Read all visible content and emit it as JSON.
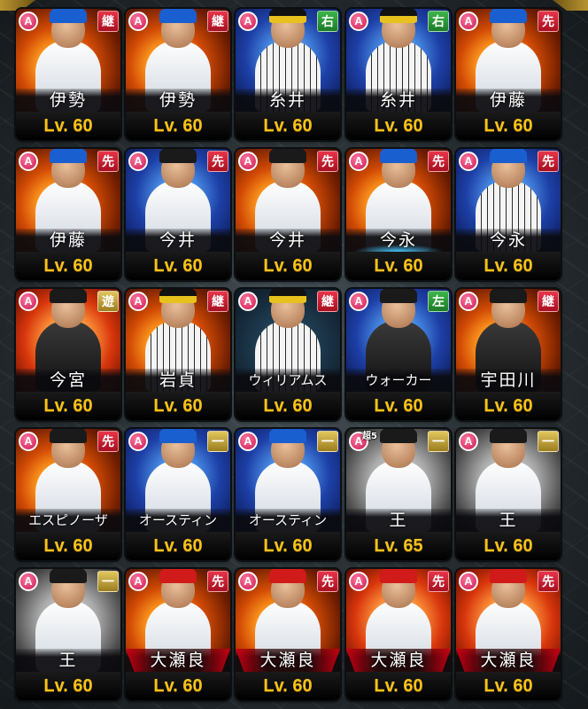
{
  "cards": [
    {
      "name": "伊勢",
      "level": "Lv. 60",
      "position": "継",
      "pos_color": "red",
      "art": "orange",
      "uniform": "white",
      "cap": "blue"
    },
    {
      "name": "伊勢",
      "level": "Lv. 60",
      "position": "継",
      "pos_color": "red",
      "art": "orange",
      "uniform": "white",
      "cap": "blue"
    },
    {
      "name": "糸井",
      "level": "Lv. 60",
      "position": "右",
      "pos_color": "green",
      "art": "blue",
      "uniform": "stripe",
      "cap": "yellow"
    },
    {
      "name": "糸井",
      "level": "Lv. 60",
      "position": "右",
      "pos_color": "green",
      "art": "blue",
      "uniform": "stripe",
      "cap": "yellow"
    },
    {
      "name": "伊藤",
      "level": "Lv. 60",
      "position": "先",
      "pos_color": "red",
      "art": "orange",
      "uniform": "white",
      "cap": "blue"
    },
    {
      "name": "伊藤",
      "level": "Lv. 60",
      "position": "先",
      "pos_color": "red",
      "art": "orange",
      "uniform": "white",
      "cap": "blue"
    },
    {
      "name": "今井",
      "level": "Lv. 60",
      "position": "先",
      "pos_color": "red",
      "art": "blue",
      "uniform": "white",
      "cap": "black"
    },
    {
      "name": "今井",
      "level": "Lv. 60",
      "position": "先",
      "pos_color": "red",
      "art": "orange",
      "uniform": "white",
      "cap": "black"
    },
    {
      "name": "今永",
      "level": "Lv. 60",
      "position": "先",
      "pos_color": "red",
      "art": "orange",
      "uniform": "white",
      "cap": "blue",
      "glow": true
    },
    {
      "name": "今永",
      "level": "Lv. 60",
      "position": "先",
      "pos_color": "red",
      "art": "blue",
      "uniform": "stripe",
      "cap": "blue"
    },
    {
      "name": "今宮",
      "level": "Lv. 60",
      "position": "遊",
      "pos_color": "gold",
      "art": "red",
      "uniform": "black",
      "cap": "black"
    },
    {
      "name": "岩貞",
      "level": "Lv. 60",
      "position": "継",
      "pos_color": "red",
      "art": "orange",
      "uniform": "stripe",
      "cap": "yellow"
    },
    {
      "name": "ウィリアムス",
      "level": "Lv. 60",
      "position": "継",
      "pos_color": "red",
      "art": "dark",
      "uniform": "stripe",
      "cap": "yellow",
      "small": true
    },
    {
      "name": "ウォーカー",
      "level": "Lv. 60",
      "position": "左",
      "pos_color": "green",
      "art": "blue",
      "uniform": "black",
      "cap": "black",
      "small": true
    },
    {
      "name": "宇田川",
      "level": "Lv. 60",
      "position": "継",
      "pos_color": "red",
      "art": "orange",
      "uniform": "black",
      "cap": "black"
    },
    {
      "name": "エスピノーザ",
      "level": "Lv. 60",
      "position": "先",
      "pos_color": "red",
      "art": "orange",
      "uniform": "white",
      "cap": "black",
      "small": true
    },
    {
      "name": "オースティン",
      "level": "Lv. 60",
      "position": "一",
      "pos_color": "gold",
      "art": "blue",
      "uniform": "white",
      "cap": "blue",
      "small": true
    },
    {
      "name": "オースティン",
      "level": "Lv. 60",
      "position": "一",
      "pos_color": "gold",
      "art": "blue",
      "uniform": "white",
      "cap": "blue",
      "small": true
    },
    {
      "name": "王",
      "level": "Lv. 65",
      "position": "一",
      "pos_color": "gold",
      "art": "grey",
      "uniform": "white",
      "cap": "black",
      "limit": "超5"
    },
    {
      "name": "王",
      "level": "Lv. 60",
      "position": "一",
      "pos_color": "gold",
      "art": "grey",
      "uniform": "white",
      "cap": "black"
    },
    {
      "name": "王",
      "level": "Lv. 60",
      "position": "一",
      "pos_color": "gold",
      "art": "grey",
      "uniform": "white",
      "cap": "black"
    },
    {
      "name": "大瀬良",
      "level": "Lv. 60",
      "position": "先",
      "pos_color": "red",
      "art": "orange",
      "uniform": "white",
      "cap": "red",
      "redglow": true
    },
    {
      "name": "大瀬良",
      "level": "Lv. 60",
      "position": "先",
      "pos_color": "red",
      "art": "orange",
      "uniform": "white",
      "cap": "red",
      "redglow": true
    },
    {
      "name": "大瀬良",
      "level": "Lv. 60",
      "position": "先",
      "pos_color": "red",
      "art": "red",
      "uniform": "white",
      "cap": "red",
      "redglow": true
    },
    {
      "name": "大瀬良",
      "level": "Lv. 60",
      "position": "先",
      "pos_color": "red",
      "art": "red",
      "uniform": "white",
      "cap": "red",
      "redglow": true
    }
  ],
  "rank_badge": "A"
}
